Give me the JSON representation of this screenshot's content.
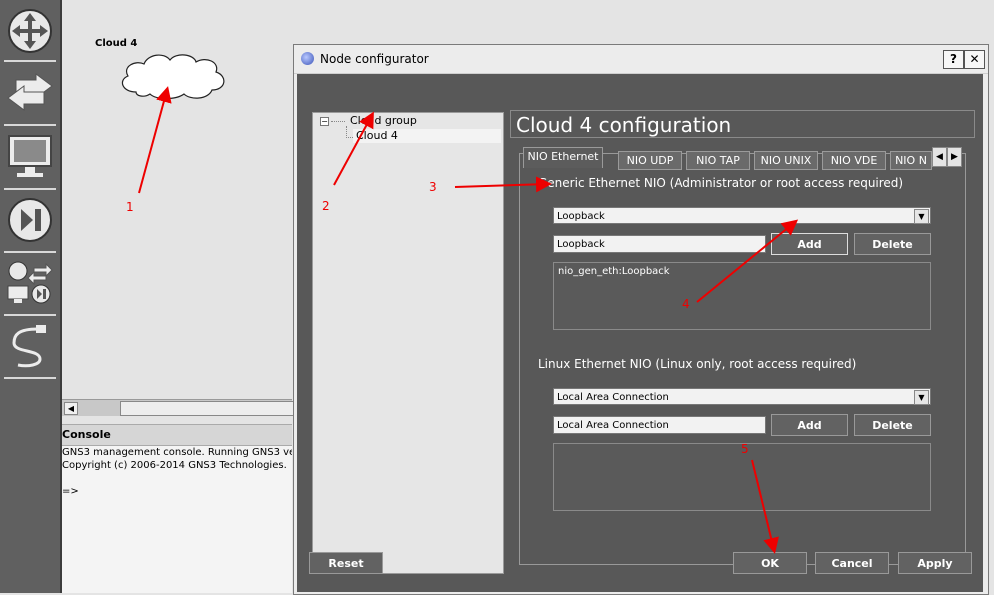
{
  "toolbar": {
    "icons": [
      "router-icon",
      "switch-icon",
      "end-device-icon",
      "security-device-icon",
      "all-devices-icon",
      "add-link-icon"
    ]
  },
  "canvas": {
    "node_label": "Cloud 4"
  },
  "console": {
    "title": "Console",
    "lines": "GNS3 management console. Running GNS3 ver\nCopyright (c) 2006-2014 GNS3 Technologies.\n\n=>"
  },
  "dialog": {
    "title": "Node configurator",
    "help_button": "?",
    "close_button": "✕",
    "tree": {
      "group": "Cloud group",
      "item": "Cloud 4"
    },
    "config_title": "Cloud 4 configuration",
    "tabs": [
      "NIO Ethernet",
      "NIO UDP",
      "NIO TAP",
      "NIO UNIX",
      "NIO VDE",
      "NIO N"
    ],
    "generic": {
      "label": "Generic Ethernet NIO (Administrator or root access required)",
      "combo_value": "Loopback",
      "field_value": "Loopback",
      "add": "Add",
      "delete": "Delete",
      "list_item": "nio_gen_eth:Loopback"
    },
    "linux": {
      "label": "Linux Ethernet NIO (Linux only, root access required)",
      "combo_value": "Local Area Connection",
      "field_value": "Local Area Connection",
      "add": "Add",
      "delete": "Delete"
    },
    "buttons": {
      "reset": "Reset",
      "ok": "OK",
      "cancel": "Cancel",
      "apply": "Apply"
    }
  },
  "annotations": [
    "1",
    "2",
    "3",
    "4",
    "5"
  ],
  "colors": {
    "annotation": "#e00000",
    "panel_dark": "#585858"
  }
}
